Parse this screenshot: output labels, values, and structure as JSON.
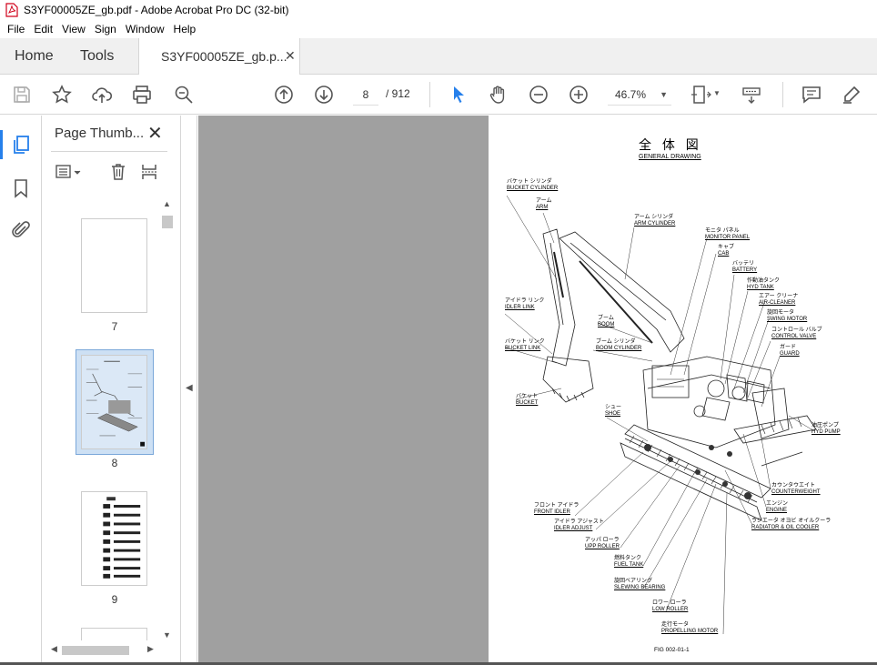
{
  "window": {
    "title": "S3YF00005ZE_gb.pdf - Adobe Acrobat Pro DC (32-bit)"
  },
  "menu": [
    "File",
    "Edit",
    "View",
    "Sign",
    "Window",
    "Help"
  ],
  "tabs": {
    "home": "Home",
    "tools": "Tools",
    "document": "S3YF00005ZE_gb.p...",
    "close": "✕"
  },
  "toolbar": {
    "page_current": "8",
    "page_total": "/ 912",
    "zoom": "46.7%"
  },
  "thumbnails": {
    "title": "Page Thumb...",
    "close": "✕",
    "pages": [
      "7",
      "8",
      "9"
    ],
    "selected_page": "8"
  },
  "document": {
    "title": "全 体 図",
    "subtitle": "GENERAL DRAWING",
    "labels": [
      {
        "jp": "バケット シリンダ",
        "en": "BUCKET CYLINDER"
      },
      {
        "jp": "アーム",
        "en": "ARM"
      },
      {
        "jp": "アーム シリンダ",
        "en": "ARM CYLINDER"
      },
      {
        "jp": "モニタ パネル",
        "en": "MONITOR PANEL"
      },
      {
        "jp": "キャブ",
        "en": "CAB"
      },
      {
        "jp": "バッテリ",
        "en": "BATTERY"
      },
      {
        "jp": "作動油タンク",
        "en": "HYD TANK"
      },
      {
        "jp": "エアー クリーナ",
        "en": "AIR-CLEANER"
      },
      {
        "jp": "旋回モータ",
        "en": "SWING MOTOR"
      },
      {
        "jp": "コントロール バルブ",
        "en": "CONTROL VALVE"
      },
      {
        "jp": "ガード",
        "en": "GUARD"
      },
      {
        "jp": "アイドラ リンク",
        "en": "IDLER LINK"
      },
      {
        "jp": "ブーム",
        "en": "BOOM"
      },
      {
        "jp": "ブーム シリンダ",
        "en": "BOOM CYLINDER"
      },
      {
        "jp": "バケット リンク",
        "en": "BUCKET LINK"
      },
      {
        "jp": "バケット",
        "en": "BUCKET"
      },
      {
        "jp": "シュー",
        "en": "SHOE"
      },
      {
        "jp": "油圧ポンプ",
        "en": "HYD PUMP"
      },
      {
        "jp": "カウンタウエイト",
        "en": "COUNTERWEIGHT"
      },
      {
        "jp": "エンジン",
        "en": "ENGINE"
      },
      {
        "jp": "ラジエータ オヨビ オイルクーラ",
        "en": "RADIATOR & OIL COOLER"
      },
      {
        "jp": "フロント アイドラ",
        "en": "FRONT IDLER"
      },
      {
        "jp": "アイドラ アジャスト",
        "en": "IDLER ADJUST"
      },
      {
        "jp": "アッパ ローラ",
        "en": "UPP ROLLER"
      },
      {
        "jp": "燃料タンク",
        "en": "FUEL TANK"
      },
      {
        "jp": "旋回ベアリング",
        "en": "SLEWING BEARING"
      },
      {
        "jp": "ロワー ローラ",
        "en": "LOW ROLLER"
      },
      {
        "jp": "走行モータ",
        "en": "PROPELLING MOTOR"
      }
    ],
    "fig_code": "FIG 002-01-1"
  }
}
